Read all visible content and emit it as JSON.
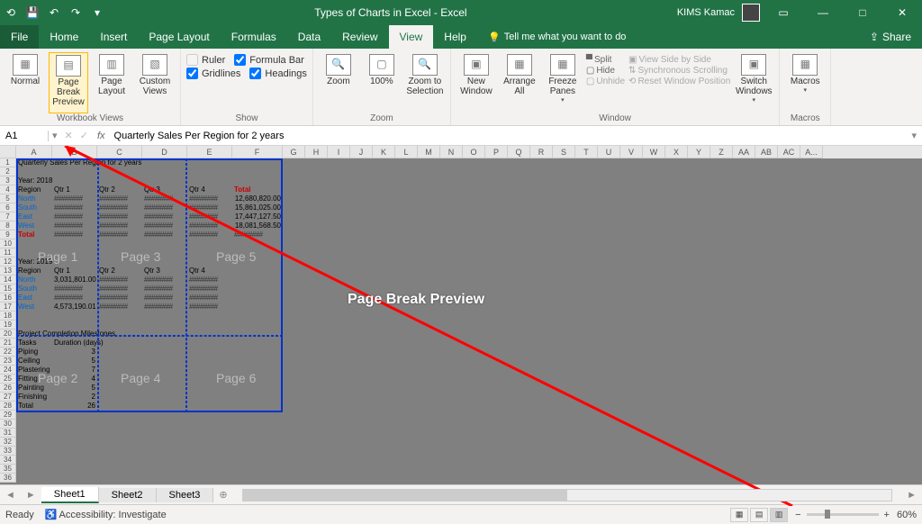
{
  "title": "Types of Charts in Excel  -  Excel",
  "user": "KIMS Kamac",
  "menu": {
    "file": "File",
    "home": "Home",
    "insert": "Insert",
    "pagelayout": "Page Layout",
    "formulas": "Formulas",
    "data": "Data",
    "review": "Review",
    "view": "View",
    "help": "Help",
    "tellme": "Tell me what you want to do",
    "share": "Share"
  },
  "ribbon": {
    "views": {
      "normal": "Normal",
      "pbp": "Page Break Preview",
      "layout": "Page Layout",
      "custom": "Custom Views",
      "title": "Workbook Views"
    },
    "show": {
      "ruler": "Ruler",
      "formulabar": "Formula Bar",
      "gridlines": "Gridlines",
      "headings": "Headings",
      "title": "Show"
    },
    "zoom": {
      "zoom": "Zoom",
      "hundred": "100%",
      "tosel": "Zoom to Selection",
      "title": "Zoom"
    },
    "window": {
      "new": "New Window",
      "arrange": "Arrange All",
      "freeze": "Freeze Panes",
      "split": "Split",
      "hide": "Hide",
      "unhide": "Unhide",
      "sbs": "View Side by Side",
      "sync": "Synchronous Scrolling",
      "reset": "Reset Window Position",
      "switch": "Switch Windows",
      "title": "Window"
    },
    "macros": {
      "label": "Macros",
      "title": "Macros"
    }
  },
  "namebox": "A1",
  "formula": "Quarterly Sales Per Region for 2 years",
  "cols": [
    "A",
    "B",
    "C",
    "D",
    "E",
    "F",
    "G",
    "H",
    "I",
    "J",
    "K",
    "L",
    "M",
    "N",
    "O",
    "P",
    "Q",
    "R",
    "S",
    "T",
    "U",
    "V",
    "W",
    "X",
    "Y",
    "Z",
    "AA",
    "AB",
    "AC",
    "A..."
  ],
  "wm": {
    "p1": "Page 1",
    "p2": "Page 2",
    "p3": "Page 3",
    "p4": "Page 4",
    "p5": "Page 5",
    "p6": "Page 6"
  },
  "data2018": {
    "title": "Quarterly Sales Per Region for 2 years",
    "year": "Year: 2018",
    "headers": [
      "Region",
      "Qtr 1",
      "Qtr 2",
      "Qtr 3",
      "Qtr 4",
      "Total"
    ],
    "rows": [
      "North",
      "South",
      "East",
      "West",
      "Total"
    ],
    "totals": [
      "12,680,820.00",
      "15,861,025.00",
      "17,447,127.50",
      "18,081,568.50"
    ]
  },
  "data2019": {
    "year": "Year: 2019",
    "headers": [
      "Region",
      "Qtr 1",
      "Qtr 2",
      "Qtr 3",
      "Qtr 4"
    ],
    "rows": [
      "North",
      "South",
      "East",
      "West"
    ],
    "vals": [
      "3,031,801.00",
      "4,573,190.01"
    ]
  },
  "milestones": {
    "title": "Project Completion Milestones",
    "headers": [
      "Tasks",
      "Duration (days)"
    ],
    "rows": [
      [
        "Piping",
        "3"
      ],
      [
        "Ceiling",
        "5"
      ],
      [
        "Plastering",
        "7"
      ],
      [
        "Fitting",
        "4"
      ],
      [
        "Painting",
        "5"
      ],
      [
        "Finishing",
        "2"
      ]
    ],
    "total": [
      "Total",
      "26"
    ]
  },
  "annotation": "Page Break Preview",
  "tabs": {
    "s1": "Sheet1",
    "s2": "Sheet2",
    "s3": "Sheet3"
  },
  "status": {
    "ready": "Ready",
    "acc": "Accessibility: Investigate",
    "zoom": "60%"
  }
}
